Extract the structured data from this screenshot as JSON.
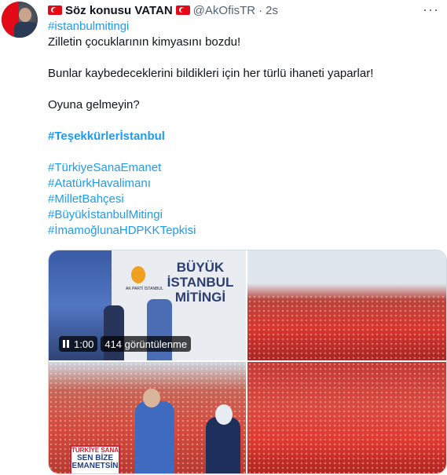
{
  "author": {
    "name": "Söz konusu VATAN",
    "handle": "@AkOfisTR",
    "separator": "·",
    "time": "2s"
  },
  "tweet": {
    "lines": [
      {
        "text": "#istanbulmitingi",
        "type": "tag"
      },
      {
        "text": "Zilletin çocuklarının kimyasını bozdu!",
        "type": "text"
      },
      {
        "text": "",
        "type": "gap"
      },
      {
        "text": "Bunlar kaybedeceklerini bildikleri için her türlü ihaneti yaparlar!",
        "type": "text"
      },
      {
        "text": "",
        "type": "gap"
      },
      {
        "text": "Oyuna gelmeyin?",
        "type": "text"
      },
      {
        "text": "",
        "type": "gap"
      },
      {
        "text": "#Teşekkürlerİstanbul",
        "type": "tag-bold"
      },
      {
        "text": "",
        "type": "gap"
      },
      {
        "text": "#TürkiyeSanaEmanet",
        "type": "tag"
      },
      {
        "text": "#AtatürkHavalimanı",
        "type": "tag"
      },
      {
        "text": "#MilletBahçesi",
        "type": "tag"
      },
      {
        "text": "#BüyükİstanbulMitingi",
        "type": "tag"
      },
      {
        "text": "#İmamoğlunaHDPKKTepkisi",
        "type": "tag"
      }
    ]
  },
  "media": {
    "video_time": "1:00",
    "views": "414 görüntülenme",
    "stage_sign": "BÜYÜK İSTANBUL MİTİNGİ",
    "akp_label": "AK PARTİ İSTANBUL",
    "banner_line1": "TÜRKİYE SANA",
    "banner_line2": "SEN BİZE",
    "banner_line3": "EMANETSİN"
  },
  "colors": {
    "link": "#1d9bf0",
    "flag_red": "#e30a17"
  },
  "icons": {
    "more": "more-icon",
    "pause": "pause-icon",
    "flag": "turkish-flag-icon"
  }
}
